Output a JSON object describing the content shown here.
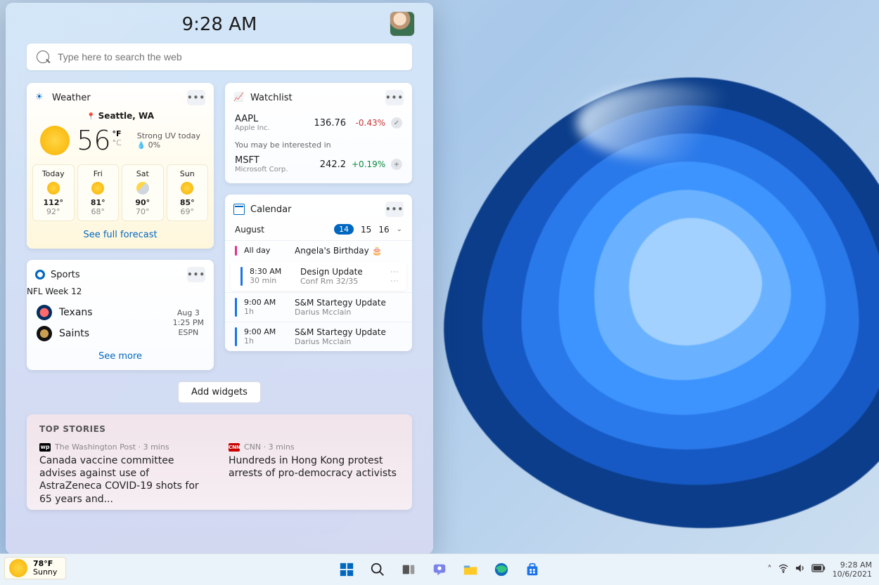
{
  "clock": "9:28 AM",
  "search_placeholder": "Type here to search the web",
  "weather": {
    "title": "Weather",
    "location": "Seattle, WA",
    "temp": "56",
    "unit1": "°F",
    "unit2": "°C",
    "cond1": "Strong UV today",
    "cond2": "0%",
    "forecast": [
      {
        "day": "Today",
        "hi": "112°",
        "lo": "92°"
      },
      {
        "day": "Fri",
        "hi": "81°",
        "lo": "68°"
      },
      {
        "day": "Sat",
        "hi": "90°",
        "lo": "70°"
      },
      {
        "day": "Sun",
        "hi": "85°",
        "lo": "69°"
      }
    ],
    "link": "See full forecast"
  },
  "sports": {
    "title": "Sports",
    "subtitle": "NFL Week 12",
    "team1": "Texans",
    "team2": "Saints",
    "date": "Aug 3",
    "time": "1:25 PM",
    "network": "ESPN",
    "more": "See more"
  },
  "watchlist": {
    "title": "Watchlist",
    "rows": [
      {
        "sym": "AAPL",
        "co": "Apple Inc.",
        "price": "136.76",
        "chg": "-0.43%",
        "dir": "down",
        "badge": "✓"
      },
      {
        "sym": "MSFT",
        "co": "Microsoft Corp.",
        "price": "242.2",
        "chg": "+0.19%",
        "dir": "up",
        "badge": "+"
      }
    ],
    "interest": "You may be interested in"
  },
  "calendar": {
    "title": "Calendar",
    "month": "August",
    "selected": "14",
    "d2": "15",
    "d3": "16",
    "events": [
      {
        "time": "All day",
        "dur": "",
        "title": "Angela's Birthday 🎂",
        "room": "",
        "color": "pink"
      },
      {
        "time": "8:30 AM",
        "dur": "30 min",
        "title": "Design Update",
        "room": "Conf Rm 32/35",
        "color": "blue",
        "sel": true
      },
      {
        "time": "9:00 AM",
        "dur": "1h",
        "title": "S&M Startegy Update",
        "room": "Darius Mcclain",
        "color": "blue"
      },
      {
        "time": "9:00 AM",
        "dur": "1h",
        "title": "S&M Startegy Update",
        "room": "Darius Mcclain",
        "color": "blue"
      }
    ]
  },
  "add_widgets": "Add widgets",
  "stories": {
    "heading": "TOP STORIES",
    "items": [
      {
        "source": "The Washington Post",
        "ago": "3 mins",
        "logo": "wp",
        "logoTxt": "wp",
        "headline": "Canada vaccine committee advises against use of AstraZeneca COVID-19 shots for 65 years and..."
      },
      {
        "source": "CNN",
        "ago": "3 mins",
        "logo": "cnn",
        "logoTxt": "CNN",
        "headline": "Hundreds in Hong Kong protest arrests of pro-democracy activists"
      }
    ]
  },
  "taskbar": {
    "temp": "78°F",
    "cond": "Sunny",
    "time": "9:28 AM",
    "date": "10/6/2021"
  }
}
